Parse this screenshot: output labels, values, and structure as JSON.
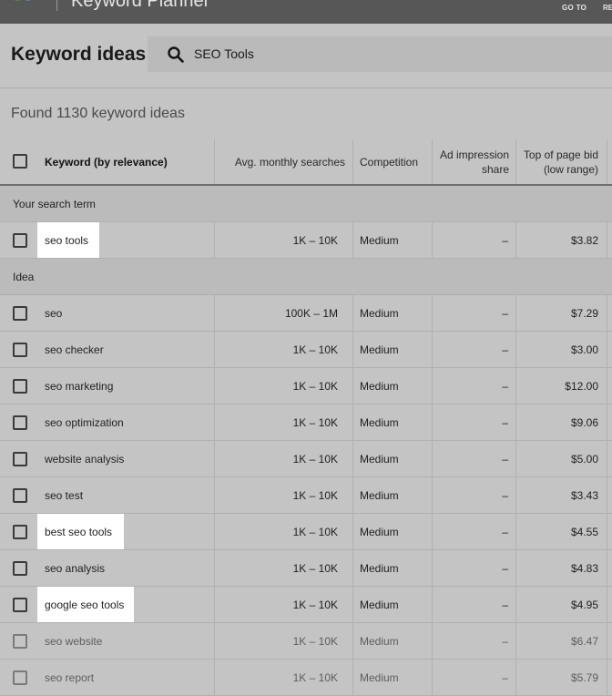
{
  "app": {
    "title": "Keyword Planner",
    "nav_goto": "GO TO",
    "nav_cut": "RE"
  },
  "header": {
    "title": "Keyword ideas",
    "search_value": "SEO Tools"
  },
  "summary": "Found 1130 keyword ideas",
  "columns": {
    "keyword": "Keyword (by relevance)",
    "searches": "Avg. monthly searches",
    "competition": "Competition",
    "impression_line1": "Ad impression",
    "impression_line2": "share",
    "bid_line1": "Top of page bid",
    "bid_line2": "(low range)"
  },
  "groups": {
    "search_term": "Your search term",
    "idea": "Idea"
  },
  "search_term_rows": [
    {
      "keyword": "seo tools",
      "searches": "1K – 10K",
      "competition": "Medium",
      "impression": "–",
      "bid": "$3.82",
      "highlighted": true
    }
  ],
  "idea_rows": [
    {
      "keyword": "seo",
      "searches": "100K – 1M",
      "competition": "Medium",
      "impression": "–",
      "bid": "$7.29",
      "highlighted": false
    },
    {
      "keyword": "seo checker",
      "searches": "1K – 10K",
      "competition": "Medium",
      "impression": "–",
      "bid": "$3.00",
      "highlighted": false
    },
    {
      "keyword": "seo marketing",
      "searches": "1K – 10K",
      "competition": "Medium",
      "impression": "–",
      "bid": "$12.00",
      "highlighted": false
    },
    {
      "keyword": "seo optimization",
      "searches": "1K – 10K",
      "competition": "Medium",
      "impression": "–",
      "bid": "$9.06",
      "highlighted": false
    },
    {
      "keyword": "website analysis",
      "searches": "1K – 10K",
      "competition": "Medium",
      "impression": "–",
      "bid": "$5.00",
      "highlighted": false
    },
    {
      "keyword": "seo test",
      "searches": "1K – 10K",
      "competition": "Medium",
      "impression": "–",
      "bid": "$3.43",
      "highlighted": false
    },
    {
      "keyword": "best seo tools",
      "searches": "1K – 10K",
      "competition": "Medium",
      "impression": "–",
      "bid": "$4.55",
      "highlighted": true
    },
    {
      "keyword": "seo analysis",
      "searches": "1K – 10K",
      "competition": "Medium",
      "impression": "–",
      "bid": "$4.83",
      "highlighted": false
    },
    {
      "keyword": "google seo tools",
      "searches": "1K – 10K",
      "competition": "Medium",
      "impression": "–",
      "bid": "$4.95",
      "highlighted": true
    },
    {
      "keyword": "seo website",
      "searches": "1K – 10K",
      "competition": "Medium",
      "impression": "–",
      "bid": "$6.47",
      "highlighted": false,
      "faded": true
    },
    {
      "keyword": "seo report",
      "searches": "1K – 10K",
      "competition": "Medium",
      "impression": "–",
      "bid": "$5.79",
      "highlighted": false,
      "faded": true
    }
  ],
  "colors": {
    "overlay_gray": "#c4c4c4",
    "highlight": "#ffffff",
    "topbar": "#575757"
  },
  "icons": {
    "search": "search-icon",
    "logo": "google-logo-icon"
  }
}
